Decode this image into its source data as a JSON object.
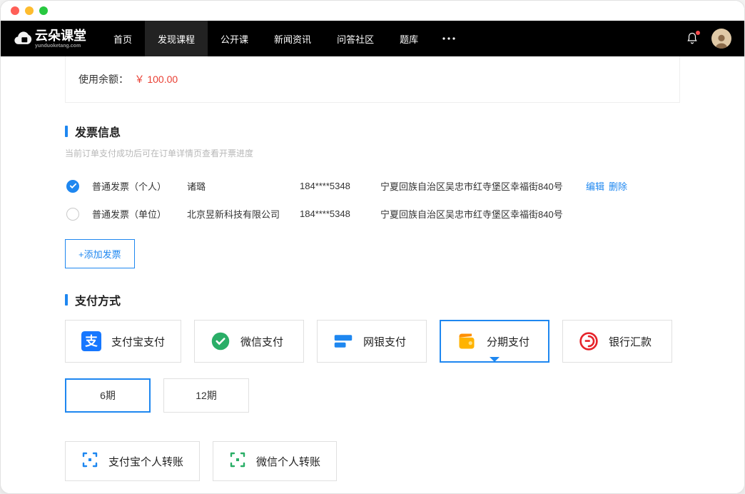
{
  "brand": {
    "name": "云朵课堂",
    "domain": "yunduoketang.com"
  },
  "nav": {
    "items": [
      "首页",
      "发现课程",
      "公开课",
      "新闻资讯",
      "问答社区",
      "题库"
    ],
    "active_index": 1
  },
  "balance": {
    "label": "使用余额：",
    "amount": "￥ 100.00"
  },
  "invoice": {
    "title": "发票信息",
    "subtitle": "当前订单支付成功后可在订单详情页查看开票进度",
    "rows": [
      {
        "type": "普通发票（个人）",
        "name": "诸璐",
        "phone": "184****5348",
        "address": "宁夏回族自治区吴忠市红寺堡区幸福街840号",
        "selected": true
      },
      {
        "type": "普通发票（单位）",
        "name": "北京昱新科技有限公司",
        "phone": "184****5348",
        "address": "宁夏回族自治区吴忠市红寺堡区幸福街840号",
        "selected": false
      }
    ],
    "actions": {
      "edit": "编辑",
      "delete": "删除"
    },
    "add_button": "+添加发票"
  },
  "payment": {
    "title": "支付方式",
    "methods": [
      {
        "id": "alipay",
        "label": "支付宝支付"
      },
      {
        "id": "wechat",
        "label": "微信支付"
      },
      {
        "id": "unionpay",
        "label": "网银支付"
      },
      {
        "id": "installment",
        "label": "分期支付",
        "selected": true
      },
      {
        "id": "bank",
        "label": "银行汇款"
      }
    ],
    "terms": [
      {
        "label": "6期",
        "selected": true
      },
      {
        "label": "12期",
        "selected": false
      }
    ],
    "transfers": [
      {
        "id": "alipay-transfer",
        "label": "支付宝个人转账"
      },
      {
        "id": "wechat-transfer",
        "label": "微信个人转账"
      }
    ]
  }
}
